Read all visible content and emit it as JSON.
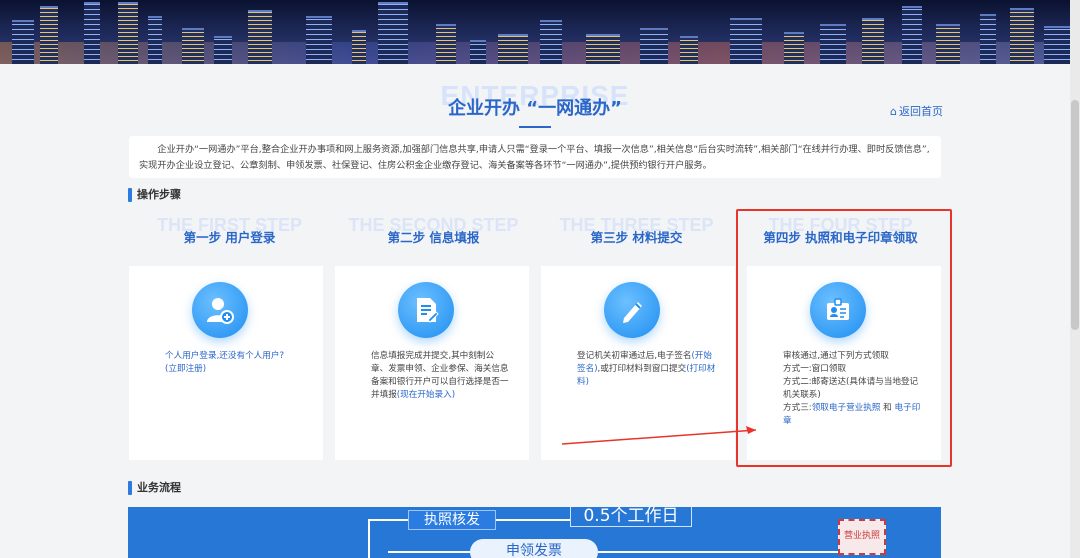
{
  "header": {
    "title_bg": "ENTERPRISE",
    "title": "企业开办 “一网通办”",
    "back_link": "返回首页"
  },
  "intro": {
    "text": "企业开办“一网通办”平台,整合企业开办事项和网上服务资源,加强部门信息共享,申请人只需“登录一个平台、填报一次信息”,相关信息“后台实时流转”,相关部门“在线并行办理、即时反馈信息”,实现开办企业设立登记、公章刻制、申领发票、社保登记、住房公积金企业缴存登记、海关备案等各环节“一网通办”,提供预约银行开户服务。"
  },
  "sections": {
    "steps": "操作步骤",
    "flow": "业务流程"
  },
  "steps": [
    {
      "bg": "THE FIRST STEP",
      "title": "第一步 用户登录",
      "icon": "user-add-icon",
      "text": "个人用户登录,还没有个人用户?",
      "link": "(立即注册)"
    },
    {
      "bg": "THE SECOND STEP",
      "title": "第二步 信息填报",
      "icon": "document-edit-icon",
      "text": "信息填报完成并提交,其中刻制公章、发票申领、企业参保、海关信息备案和银行开户可以自行选择是否一并填报",
      "link": "(现在开始录入)"
    },
    {
      "bg": "THE THREE STEP",
      "title": "第三步 材料提交",
      "icon": "pen-icon",
      "text1": "登记机关初审通过后,电子签名",
      "link1": "(开始签名)",
      "text2": ",或打印材料到窗口提交",
      "link2": "(打印材料)"
    },
    {
      "bg": "THE FOUR STEP",
      "title": "第四步 执照和电子印章领取",
      "icon": "id-card-icon",
      "line1": "审核通过,通过下列方式领取",
      "line2": "方式一:窗口领取",
      "line3": "方式二:邮寄送达(具体请与当地登记机关联系)",
      "line4_prefix": "方式三:",
      "link_license": "领取电子营业执照",
      "and": " 和 ",
      "link_seal": "电子印章"
    }
  ],
  "flow": {
    "box1": "执照核发",
    "box2": "0.5个工作日",
    "oval": "申领发票",
    "stamp": "营业执照"
  },
  "colors": {
    "accent": "#2a67c8",
    "highlight": "#e8342b",
    "icon_blue": "#1f8ef1"
  }
}
